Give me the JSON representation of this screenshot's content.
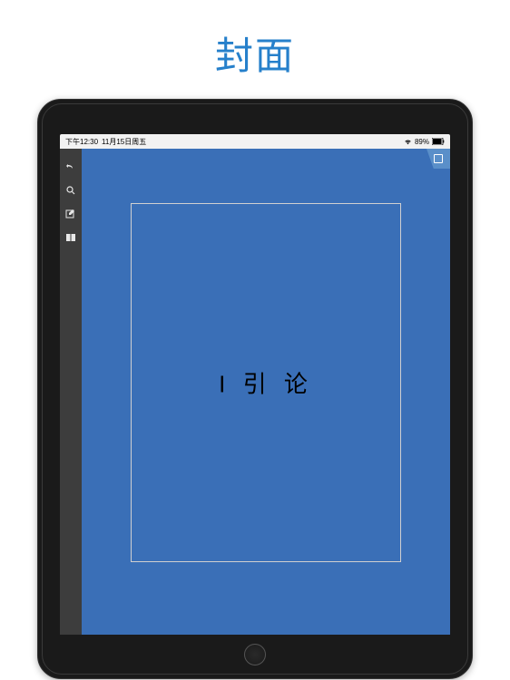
{
  "header": {
    "title": "封面"
  },
  "status_bar": {
    "time": "下午12:30",
    "date": "11月15日周五",
    "battery_percent": "89%"
  },
  "document": {
    "page_title": "I 引 论"
  },
  "icons": {
    "undo": "undo",
    "search": "search",
    "edit": "edit",
    "layout": "layout",
    "bookmark": "bookmark",
    "wifi": "wifi",
    "battery": "battery"
  }
}
